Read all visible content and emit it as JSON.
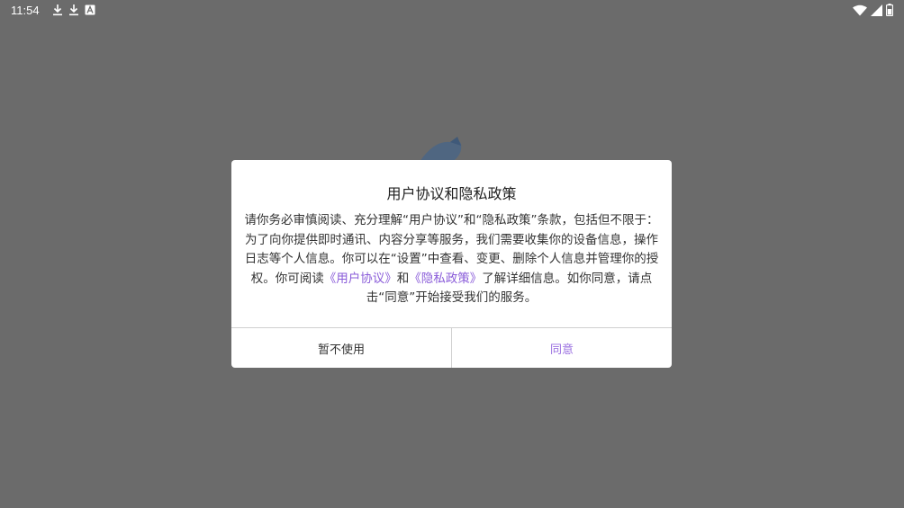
{
  "status_bar": {
    "time": "11:54",
    "left_icons": [
      "download-icon",
      "download-icon",
      "a-box-icon"
    ],
    "right_icons": [
      "wifi-icon",
      "signal-icon",
      "battery-icon"
    ]
  },
  "dialog": {
    "title": "用户协议和隐私政策",
    "body_part1": "请你务必审慎阅读、充分理解“用户协议”和“隐私政策”条款，包括但不限于：为了向你提供即时通讯、内容分享等服务，我们需要收集你的设备信息，操作日志等个人信息。你可以在“设置”中查看、变更、删除个人信息并管理你的授权。你可阅读",
    "link_user_agreement": "《用户协议》",
    "body_and": "和",
    "link_privacy_policy": "《隐私政策》",
    "body_part2": "了解详细信息。如你同意，请点击“同意”开始接受我们的服务。",
    "decline_label": "暂不使用",
    "accept_label": "同意"
  },
  "colors": {
    "overlay": "#6b6b6b",
    "link": "#8a5cd9",
    "accept": "#9a6fe0"
  }
}
